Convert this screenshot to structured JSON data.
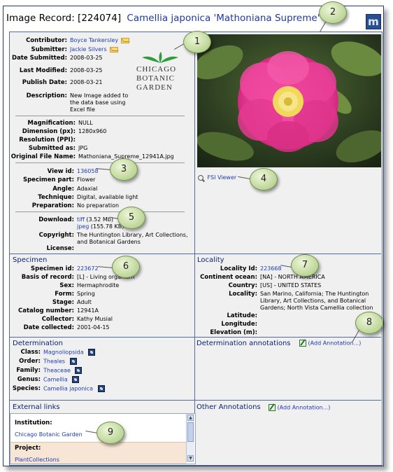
{
  "header": {
    "title": "Image Record: [224074]",
    "taxon": "Camellia japonica 'Mathoniana Supreme'",
    "logo": "m"
  },
  "record": [
    {
      "label": "Contributor:",
      "value": "Boyce Tankersley",
      "link": true,
      "mail": true
    },
    {
      "label": "Submitter:",
      "value": "Jackie Silvers",
      "link": true,
      "mail": true
    },
    {
      "label": "Date Submitted:",
      "value": "2008-03-25"
    },
    {
      "label": "Last Modified:",
      "value": "2008-03-25"
    },
    {
      "label": "Publish Date:",
      "value": "2008-03-21"
    },
    {
      "label": "Description:",
      "value_lines": [
        "New Image added to",
        "the data base using",
        "Excel file"
      ]
    }
  ],
  "org_logo": {
    "lines": [
      "CHICAGO",
      "BOTANIC",
      "GARDEN"
    ],
    "icon": "leaf-logo-icon"
  },
  "technical": [
    {
      "label": "Magnification:",
      "value": "NULL"
    },
    {
      "label": "Dimension (px):",
      "value": "1280x960"
    },
    {
      "label": "Resolution (PPI):",
      "value": ""
    },
    {
      "label": "Submitted as:",
      "value": "JPG"
    },
    {
      "label": "Original File Name:",
      "value": "Mathoniana_Supreme_12941A.jpg"
    }
  ],
  "view": [
    {
      "label": "View id:",
      "value": "136058",
      "link": true
    },
    {
      "label": "Specimen part:",
      "value": "Flower"
    },
    {
      "label": "Angle:",
      "value": "Adaxial"
    },
    {
      "label": "Technique:",
      "value": "Digital, available light"
    },
    {
      "label": "Preparation:",
      "value": "No preparation"
    }
  ],
  "download": {
    "label": "Download:",
    "tiff_link": "tiff",
    "tiff_size": "(3.52 Mb)",
    "jpeg_link": "jpeg",
    "jpeg_size": "(155.78 KB)",
    "copyright_label": "Copyright:",
    "copyright_lines": [
      "The Huntington Library, Art Collections,",
      "and Botanical Gardens"
    ],
    "license_label": "License:"
  },
  "fsi_viewer": "FSI Viewer",
  "specimen": {
    "title": "Specimen",
    "rows": [
      {
        "label": "Specimen id:",
        "value": "223672",
        "link": true
      },
      {
        "label": "Basis of record:",
        "value": "[L] - Living organism"
      },
      {
        "label": "Sex:",
        "value": "Hermaphrodite"
      },
      {
        "label": "Form:",
        "value": "Spring"
      },
      {
        "label": "Stage:",
        "value": "Adult"
      },
      {
        "label": "Catalog number:",
        "value": "12941A"
      },
      {
        "label": "Collector:",
        "value": "Kathy Musial"
      },
      {
        "label": "Date collected:",
        "value": "2001-04-15"
      }
    ]
  },
  "locality": {
    "title": "Locality",
    "rows": [
      {
        "label": "Locality Id:",
        "value": "223668",
        "link": true
      },
      {
        "label": "Continent ocean:",
        "value": "[NA] - NORTH AMERICA"
      },
      {
        "label": "Country:",
        "value": "[US] - UNITED STATES"
      },
      {
        "label": "Locality:",
        "value_lines": [
          "San Marino, California; The Huntington",
          "Library, Art Collections, and Botanical",
          "Gardens; North Vista Camellia collection"
        ]
      },
      {
        "label": "Latitude:",
        "value": ""
      },
      {
        "label": "Longitude:",
        "value": ""
      },
      {
        "label": "Elevation (m):",
        "value": ""
      }
    ]
  },
  "determination": {
    "title": "Determination",
    "rows": [
      {
        "label": "Class:",
        "value": "Magnoliopsida"
      },
      {
        "label": "Order:",
        "value": "Theales"
      },
      {
        "label": "Family:",
        "value": "Theaceae"
      },
      {
        "label": "Genus:",
        "value": "Camellia"
      },
      {
        "label": "Species:",
        "value": "Camellia japonica"
      }
    ]
  },
  "determination_annotations": {
    "title": "Determination annotations",
    "add_label": "(Add Annotation...)"
  },
  "external_links": {
    "title": "External links",
    "institution_label": "Institution:",
    "institution_value": "Chicago Botanic Garden",
    "project_label": "Project:",
    "project_value": "PlantCollections"
  },
  "other_annotations": {
    "title": "Other Annotations",
    "add_label": "(Add Annotation...)"
  },
  "callouts": [
    "1",
    "2",
    "3",
    "4",
    "5",
    "6",
    "7",
    "8",
    "9"
  ],
  "colors": {
    "link": "#1f3bb3",
    "title": "#0b2474",
    "border": "#556b98",
    "callout": "#c7e0a0",
    "panel": "#f0f0f0",
    "project_bg": "#f7e6d5"
  }
}
